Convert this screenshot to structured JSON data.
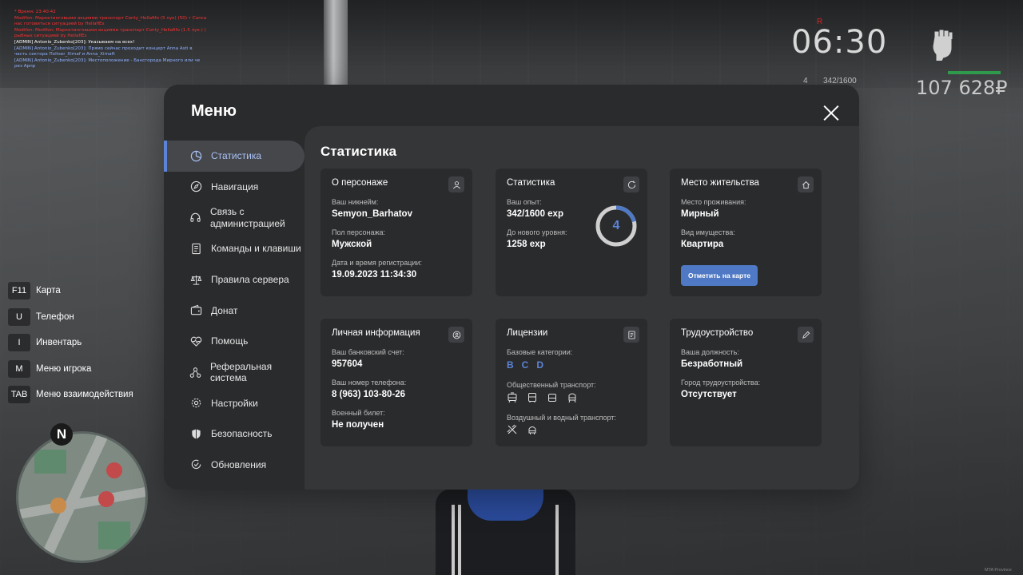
{
  "chat": [
    {
      "c": "red",
      "t": "* Время: 23:40:42"
    },
    {
      "c": "red",
      "t": "Modifon: Маркетинговыми акциями транспорт Conty_Hellafifo (5 лук) (50) • Сапсаn"
    },
    {
      "c": "red",
      "t": "нас готовиться ситуацией by HellaflEs"
    },
    {
      "c": "red",
      "t": "Modifon: Modifon: Маркетинговыми акциями транспорт Conty_Hellafifo (1.5 лук.) (Сапсаn) Маркетинговый анализ"
    },
    {
      "c": "red",
      "t": "рыбных ситуацией by HellaflEs"
    },
    {
      "c": "white",
      "t": "[ADMIN] Antonio_Zubenko[203]: Указываем на всех!"
    },
    {
      "c": "blue",
      "t": "[ADMIN] Antonio_Zubenko[203]: Прямо сейчас проходит концерт Anna Asti в"
    },
    {
      "c": "blue",
      "t": "часть сектора Пoltser_Xirnaf и Anna_Xirnaft"
    },
    {
      "c": "blue",
      "t": "[ADMIN] Antonio_Zubenko[203]: Местоположение - Бансгорода Мирного или чe"
    },
    {
      "c": "blue",
      "t": "рез Арпр"
    }
  ],
  "hud": {
    "red_mark": "R",
    "time": "06:30",
    "level": "4",
    "exp": "342/1600",
    "money": "107 628₽"
  },
  "hotkeys": [
    {
      "key": "F11",
      "label": "Карта"
    },
    {
      "key": "U",
      "label": "Телефон"
    },
    {
      "key": "I",
      "label": "Инвентарь"
    },
    {
      "key": "M",
      "label": "Меню игрока"
    },
    {
      "key": "TAB",
      "label": "Меню взаимодействия"
    }
  ],
  "minimap": {
    "north": "N"
  },
  "menu": {
    "title": "Меню",
    "sidebar": [
      {
        "label": "Статистика",
        "icon": "pie-chart-icon",
        "active": true
      },
      {
        "label": "Навигация",
        "icon": "compass-icon"
      },
      {
        "label": "Связь с администрацией",
        "icon": "headset-icon"
      },
      {
        "label": "Команды и клавиши",
        "icon": "document-icon"
      },
      {
        "label": "Правила сервера",
        "icon": "scales-icon"
      },
      {
        "label": "Донат",
        "icon": "wallet-icon"
      },
      {
        "label": "Помощь",
        "icon": "heart-icon"
      },
      {
        "label": "Реферальная система",
        "icon": "network-icon"
      },
      {
        "label": "Настройки",
        "icon": "gear-icon"
      },
      {
        "label": "Безопасность",
        "icon": "shield-icon"
      },
      {
        "label": "Обновления",
        "icon": "refresh-check-icon"
      }
    ],
    "content_title": "Статистика",
    "cards": {
      "character": {
        "title": "О персонаже",
        "nick_label": "Ваш никнейм:",
        "nick": "Semyon_Barhatov",
        "gender_label": "Пол персонажа:",
        "gender": "Мужской",
        "reg_label": "Дата и время регистрации:",
        "reg": "19.09.2023 11:34:30"
      },
      "stats": {
        "title": "Статистика",
        "exp_label": "Ваш опыт:",
        "exp": "342/1600 exp",
        "next_label": "До нового уровня:",
        "next": "1258 exp",
        "level": "4",
        "progress": 0.21
      },
      "residence": {
        "title": "Место жительства",
        "place_label": "Место проживания:",
        "place": "Мирный",
        "type_label": "Вид имущества:",
        "type": "Квартира",
        "button": "Отметить на карте"
      },
      "personal": {
        "title": "Личная информация",
        "bank_label": "Ваш банковский счет:",
        "bank": "957604",
        "phone_label": "Ваш номер телефона:",
        "phone": "8 (963) 103-80-26",
        "military_label": "Военный билет:",
        "military": "Не получен"
      },
      "licenses": {
        "title": "Лицензии",
        "base_label": "Базовые категории:",
        "base": [
          "B",
          "C",
          "D"
        ],
        "public_label": "Общественный транспорт:",
        "air_label": "Воздушный и водный транспорт:"
      },
      "job": {
        "title": "Трудоустройство",
        "pos_label": "Ваша должность:",
        "pos": "Безработный",
        "city_label": "Город трудоустройства:",
        "city": "Отсутствует"
      }
    }
  },
  "watermark": "MTA Province"
}
